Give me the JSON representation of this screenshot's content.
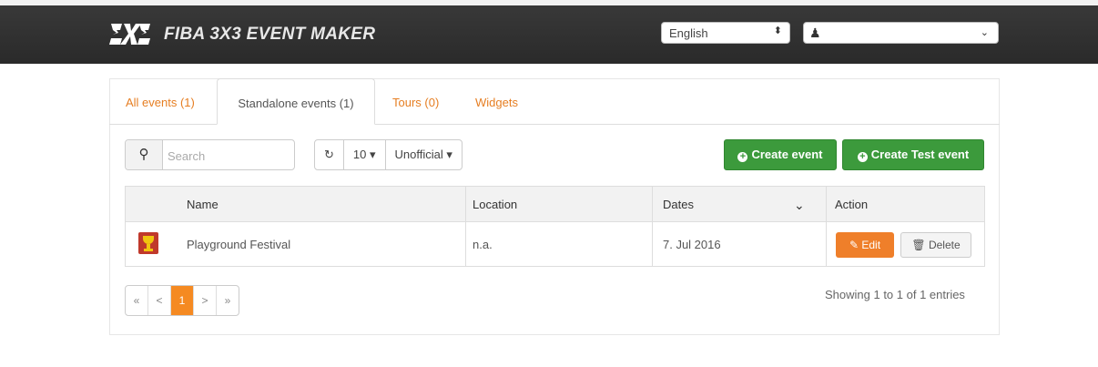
{
  "header": {
    "app_title": "FIBA 3X3 EVENT MAKER",
    "language": "English",
    "user": ""
  },
  "tabs": [
    {
      "label": "All events (1)",
      "active": false
    },
    {
      "label": "Standalone events (1)",
      "active": true
    },
    {
      "label": "Tours (0)",
      "active": false
    },
    {
      "label": "Widgets",
      "active": false
    }
  ],
  "toolbar": {
    "search_placeholder": "Search",
    "page_size": "10",
    "filter": "Unofficial",
    "create_event": "Create event",
    "create_test_event": "Create Test event"
  },
  "table": {
    "columns": [
      "Name",
      "Location",
      "Dates",
      "Action"
    ],
    "rows": [
      {
        "name": "Playground Festival",
        "location": "n.a.",
        "dates": "7. Jul 2016",
        "edit": "Edit",
        "delete": "Delete"
      }
    ]
  },
  "pagination": {
    "first": "«",
    "prev": "<",
    "current": "1",
    "next": ">",
    "last": "»",
    "info": "Showing 1 to 1 of 1 entries"
  },
  "colors": {
    "accent_orange": "#ef7f2a",
    "green": "#3c9a3c",
    "header_dark": "#2e2e2e"
  }
}
